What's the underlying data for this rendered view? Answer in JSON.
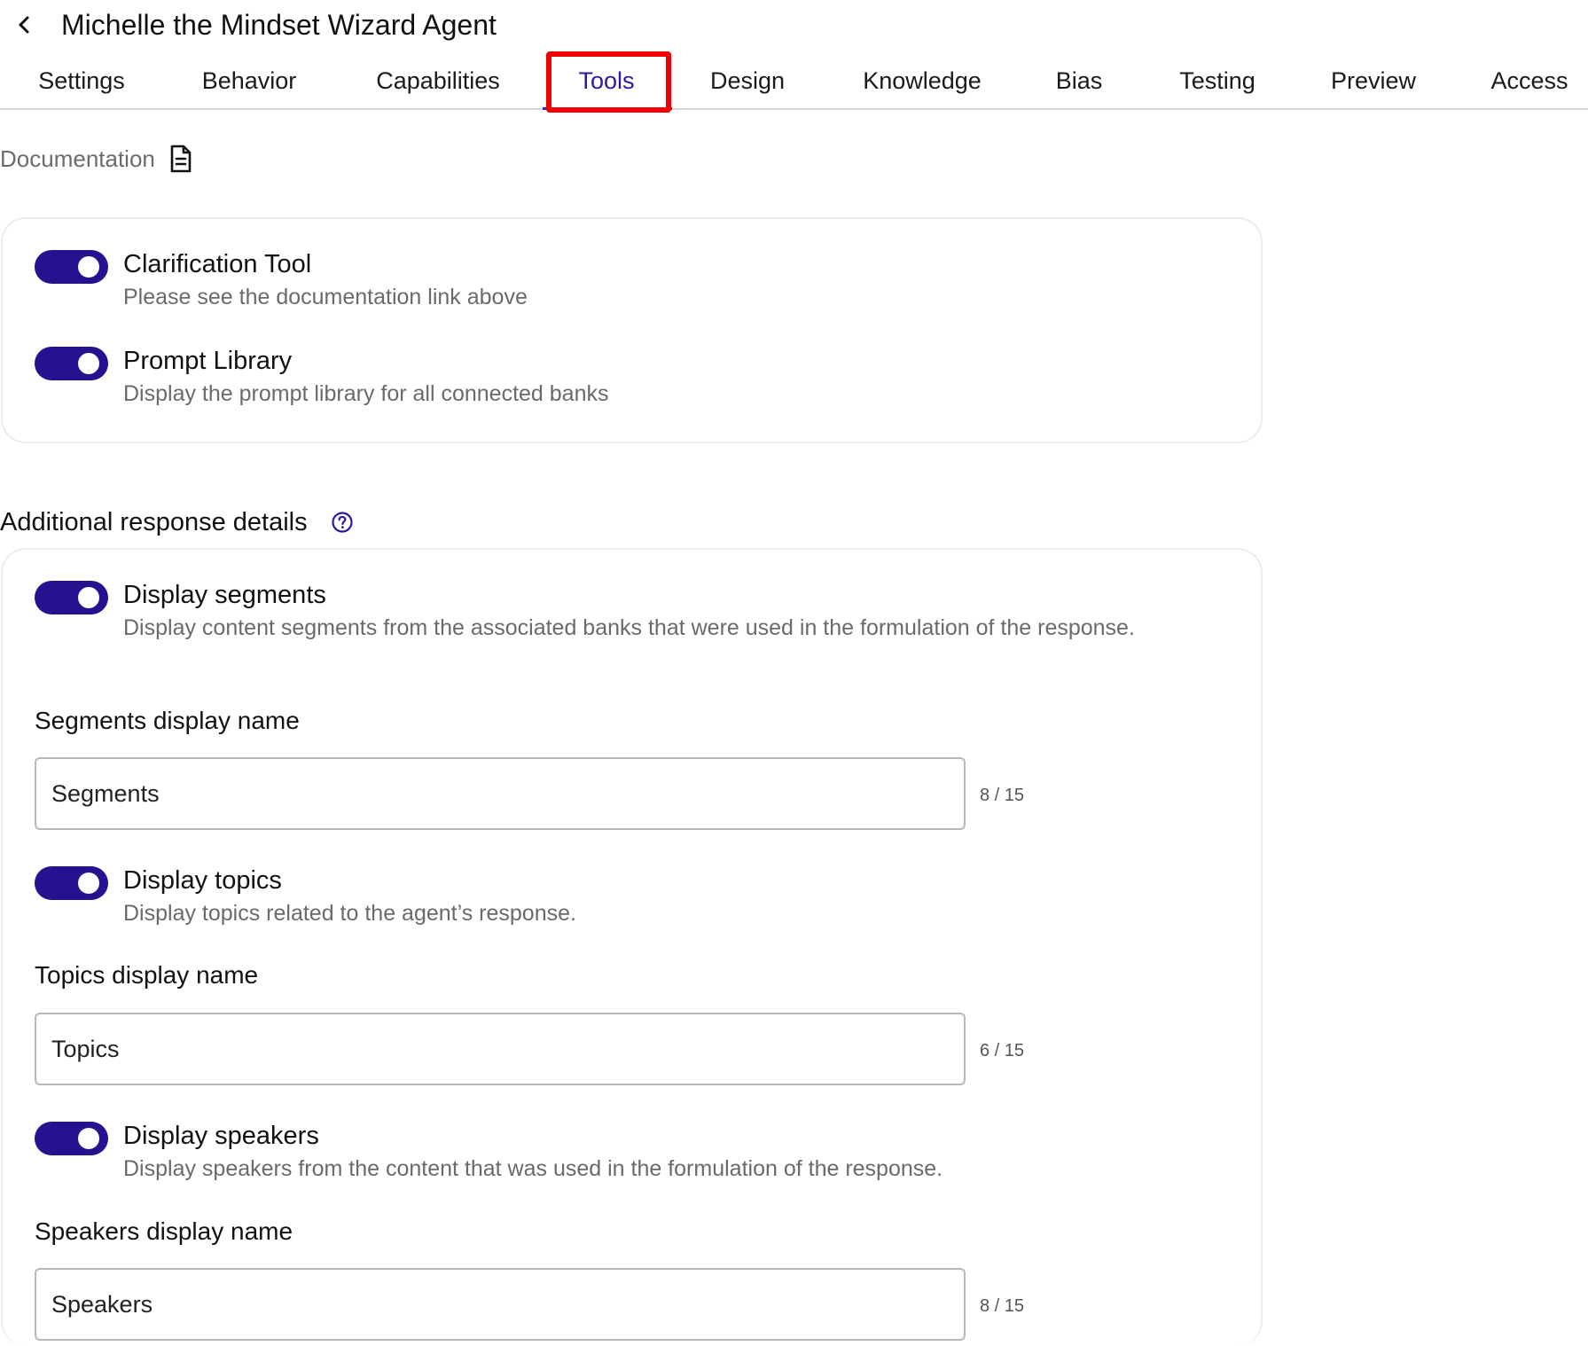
{
  "header": {
    "title": "Michelle the Mindset Wizard Agent",
    "back_icon": "chevron-left-icon"
  },
  "tabs": [
    {
      "label": "Settings",
      "active": false
    },
    {
      "label": "Behavior",
      "active": false
    },
    {
      "label": "Capabilities",
      "active": false
    },
    {
      "label": "Tools",
      "active": true
    },
    {
      "label": "Design",
      "active": false
    },
    {
      "label": "Knowledge",
      "active": false
    },
    {
      "label": "Bias",
      "active": false
    },
    {
      "label": "Testing",
      "active": false
    },
    {
      "label": "Preview",
      "active": false
    },
    {
      "label": "Access",
      "active": false
    }
  ],
  "documentation": {
    "label": "Documentation",
    "icon": "document-icon"
  },
  "tools": [
    {
      "title": "Clarification Tool",
      "description": "Please see the documentation link above",
      "enabled": true
    },
    {
      "title": "Prompt Library",
      "description": "Display the prompt library for all connected banks",
      "enabled": true
    }
  ],
  "additional_details": {
    "title": "Additional response details",
    "help_icon": "question-circle-icon",
    "segments": {
      "toggle_title": "Display segments",
      "toggle_description": "Display content segments from the associated banks that were used in the formulation of the response.",
      "enabled": true,
      "field_label": "Segments display name",
      "value": "Segments",
      "count": "8 / 15"
    },
    "topics": {
      "toggle_title": "Display topics",
      "toggle_description": "Display topics related to the agent’s response.",
      "enabled": true,
      "field_label": "Topics display name",
      "value": "Topics",
      "count": "6 / 15"
    },
    "speakers": {
      "toggle_title": "Display speakers",
      "toggle_description": "Display speakers from the content that was used in the formulation of the response.",
      "enabled": true,
      "field_label": "Speakers display name",
      "value": "Speakers",
      "count": "8 / 15"
    }
  },
  "colors": {
    "accent": "#24128f",
    "active_tab_text": "#2a1a9e",
    "highlight_box": "#f00000"
  }
}
